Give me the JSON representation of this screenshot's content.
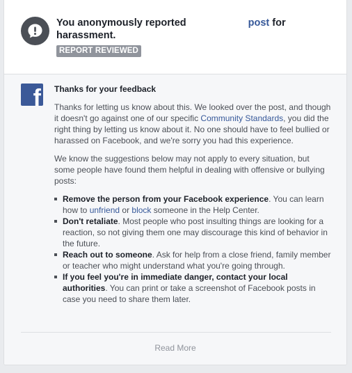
{
  "header": {
    "headline_part1": "You anonymously reported",
    "headline_link": "post",
    "headline_part2": "for harassment.",
    "badge": "REPORT REVIEWED"
  },
  "feedback": {
    "title": "Thanks for your feedback",
    "para1_a": "Thanks for letting us know about this. We looked over the post, and though it doesn't go against one of our specific ",
    "para1_link": "Community Standards",
    "para1_b": ", you did the right thing by letting us know about it. No one should have to feel bullied or harassed on Facebook, and we're sorry you had this experience.",
    "para2": "We know the suggestions below may not apply to every situation, but some people have found them helpful in dealing with offensive or bullying posts:",
    "tips": [
      {
        "bold": "Remove the person from your Facebook experience",
        "text_a": ". You can learn how to ",
        "link1": "unfriend",
        "text_b": " or ",
        "link2": "block",
        "text_c": " someone in the Help Center."
      },
      {
        "bold": "Don't retaliate",
        "text": ". Most people who post insulting things are looking for a reaction, so not giving them one may discourage this kind of behavior in the future."
      },
      {
        "bold": "Reach out to someone",
        "text": ". Ask for help from a close friend, family member or teacher who might understand what you're going through."
      },
      {
        "bold": "If you feel you're in immediate danger, contact your local authorities",
        "text": ". You can print or take a screenshot of Facebook posts in case you need to share them later."
      }
    ]
  },
  "footer": {
    "read_more": "Read More"
  },
  "icons": {
    "alert": "alert-bubble-icon",
    "logo": "facebook-logo-icon"
  },
  "colors": {
    "link": "#365899",
    "badge_bg": "#90949c",
    "brand": "#3b5998"
  }
}
